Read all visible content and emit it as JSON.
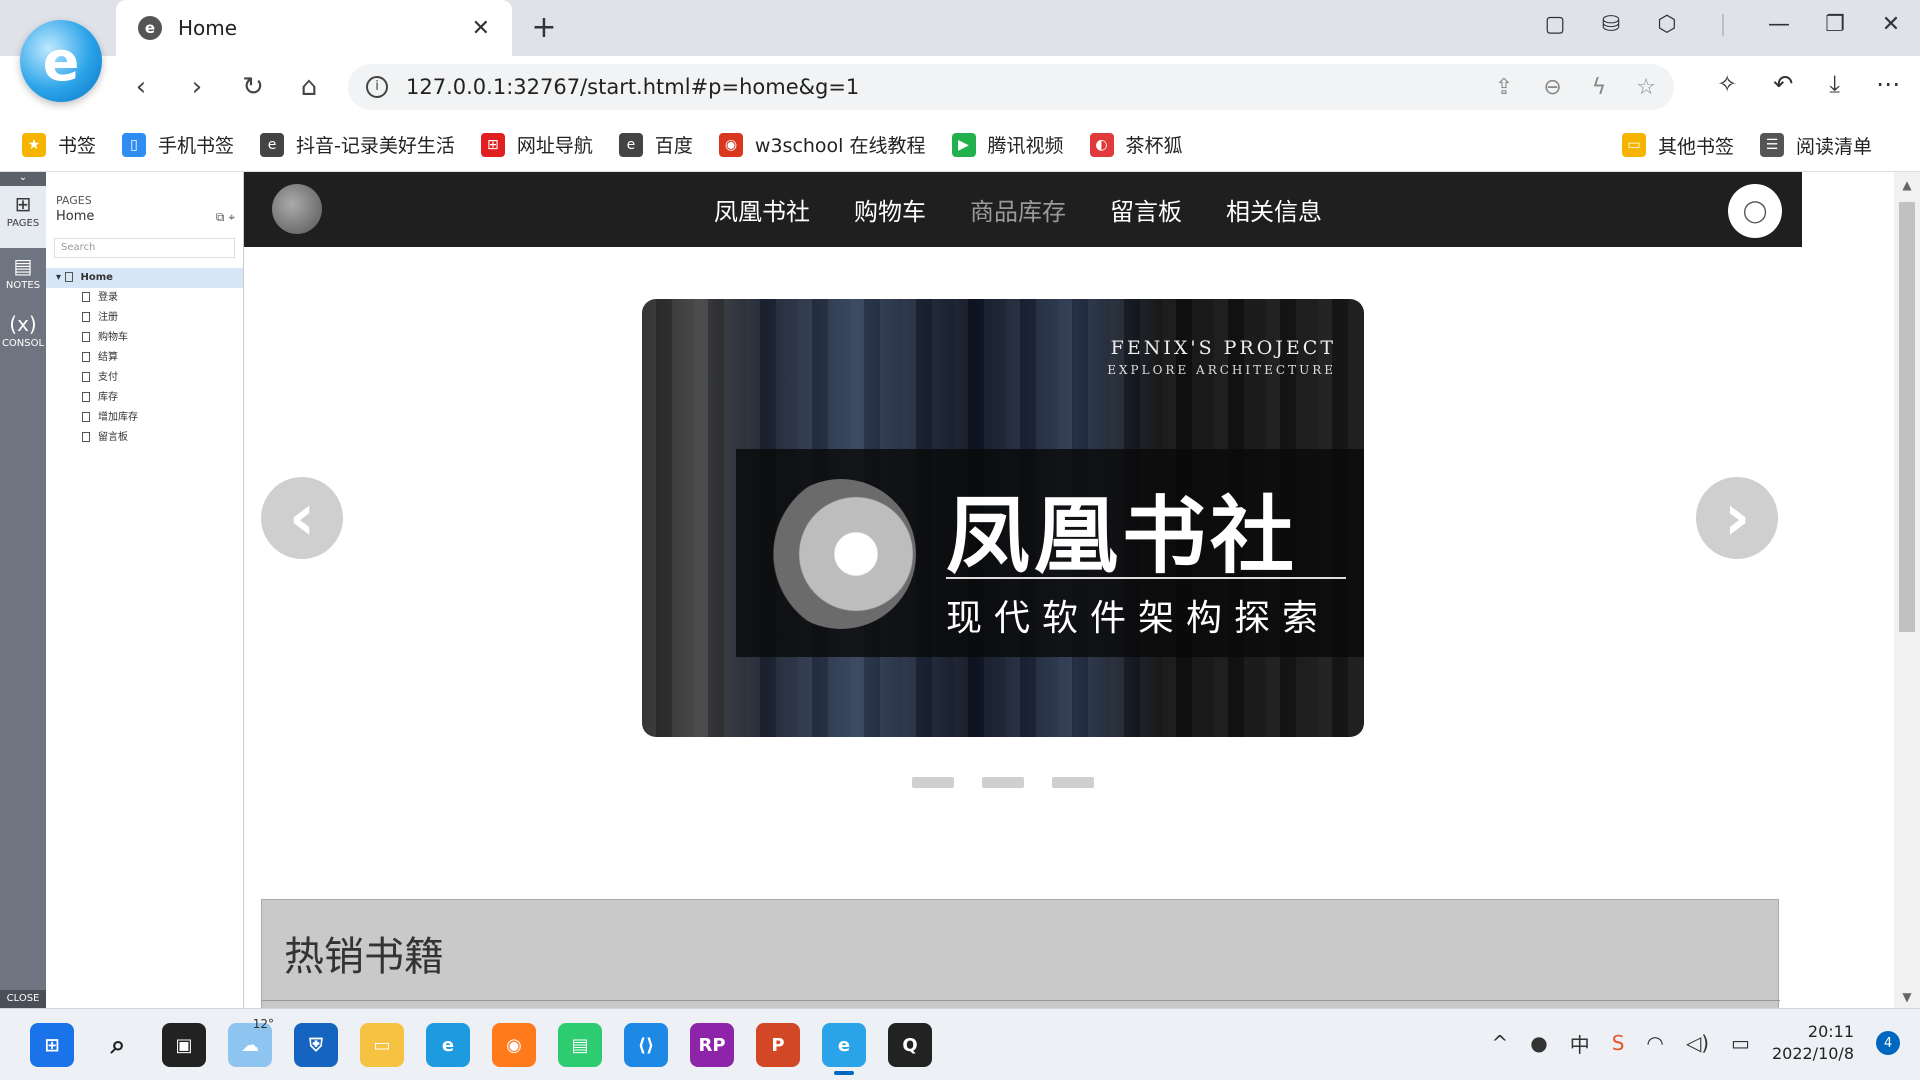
{
  "browser": {
    "tab_title": "Home",
    "tab_close": "✕",
    "new_tab": "+",
    "url": "127.0.0.1:32767/start.html#p=home&g=1"
  },
  "bookmarks": [
    {
      "label": "书签",
      "color": "#f5b400",
      "icon": "★"
    },
    {
      "label": "手机书签",
      "color": "#2f8cf0",
      "icon": "▯"
    },
    {
      "label": "抖音-记录美好生活",
      "color": "#444444",
      "icon": "e"
    },
    {
      "label": "网址导航",
      "color": "#e02020",
      "icon": "⊞"
    },
    {
      "label": "百度",
      "color": "#444444",
      "icon": "e"
    },
    {
      "label": "w3school 在线教程",
      "color": "#d9381e",
      "icon": "◉"
    },
    {
      "label": "腾讯视频",
      "color": "#22b14c",
      "icon": "▶"
    },
    {
      "label": "茶杯狐",
      "color": "#e03a3a",
      "icon": "◐"
    }
  ],
  "bookmarks_right": [
    {
      "label": "其他书签",
      "color": "#f5b400",
      "icon": "▭"
    },
    {
      "label": "阅读清单",
      "color": "#555555",
      "icon": "☰"
    }
  ],
  "axure": {
    "rail": {
      "pages": "PAGES",
      "notes": "NOTES",
      "console": "CONSOL",
      "close": "CLOSE"
    },
    "panel_label": "PAGES",
    "current_page": "Home",
    "search_placeholder": "Search",
    "tree_root": "Home",
    "tree_children": [
      "登录",
      "注册",
      "购物车",
      "结算",
      "支付",
      "库存",
      "增加库存",
      "留言板"
    ]
  },
  "site": {
    "menu": [
      "凤凰书社",
      "购物车",
      "商品库存",
      "留言板",
      "相关信息"
    ],
    "menu_dimmed_index": 2
  },
  "banner": {
    "project": "FENIX'S PROJECT",
    "subtitle": "EXPLORE ARCHITECTURE",
    "main": "凤凰书社",
    "tagline": "现代软件架构探索"
  },
  "carousel": {
    "slide_count": 3,
    "prev": "‹",
    "next": "›"
  },
  "hot_section": {
    "title": "热销书籍"
  },
  "taskbar": {
    "weather_temp": "12°",
    "time": "20:11",
    "date": "2022/10/8",
    "ime": "中",
    "notifications": "4"
  }
}
